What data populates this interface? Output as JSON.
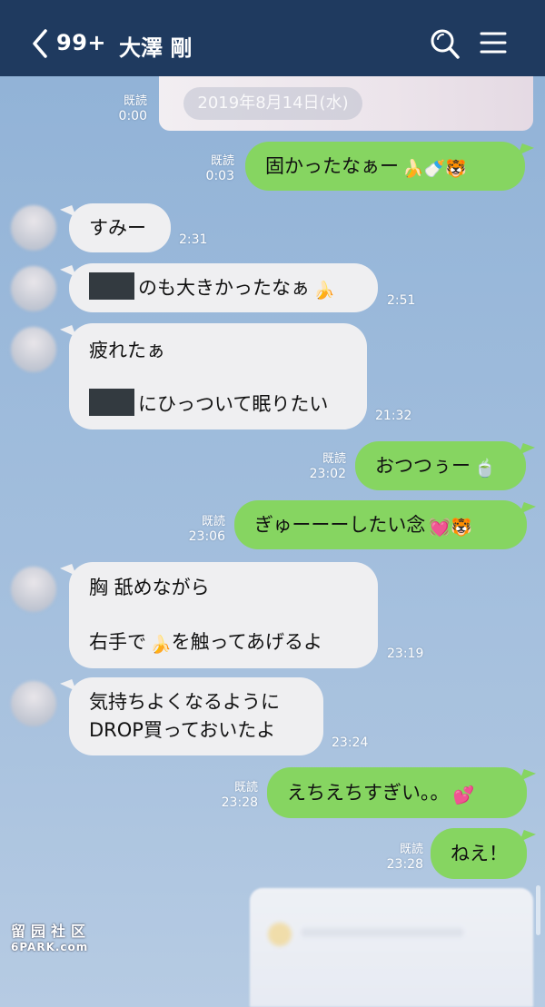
{
  "header": {
    "unread_badge": "99+",
    "contact_name": "大澤 剛"
  },
  "date_label": "2019年8月14日(水)",
  "messages": [
    {
      "dir": "out",
      "read": "既読",
      "time": "0:00",
      "text": ""
    },
    {
      "dir": "out",
      "read": "既読",
      "time": "0:03",
      "text": "固かったなぁー",
      "emojis": "🍌🍼🐯"
    },
    {
      "dir": "in",
      "time": "2:31",
      "text": "すみー"
    },
    {
      "dir": "in",
      "time": "2:51",
      "text": "のも大きかったなぁ",
      "emojis": "🍌"
    },
    {
      "dir": "in",
      "time": "21:32",
      "line1": "疲れたぁ",
      "line2": "にひっついて眠りたい"
    },
    {
      "dir": "out",
      "read": "既読",
      "time": "23:02",
      "text": "おつつぅー",
      "emojis": "🍵"
    },
    {
      "dir": "out",
      "read": "既読",
      "time": "23:06",
      "text": "ぎゅーーーしたい念",
      "emojis": "💓🐯"
    },
    {
      "dir": "in",
      "time": "23:19",
      "line1": "胸 舐めながら",
      "line2a": "右手で",
      "line2_emoji": "🍌",
      "line2b": "を触ってあげるよ"
    },
    {
      "dir": "in",
      "time": "23:24",
      "line1": "気持ちよくなるように",
      "line2": "DROP買っておいたよ"
    },
    {
      "dir": "out",
      "read": "既読",
      "time": "23:28",
      "text": "えちえちすぎい。。",
      "emojis": "💕"
    },
    {
      "dir": "out",
      "read": "既読",
      "time": "23:28",
      "text": "ねえ！"
    }
  ],
  "watermark": {
    "line1": "留园社区",
    "line2": "6PARK.com"
  },
  "icons": {
    "back": "chevron-left-icon",
    "search": "search-icon",
    "menu": "hamburger-menu-icon"
  }
}
